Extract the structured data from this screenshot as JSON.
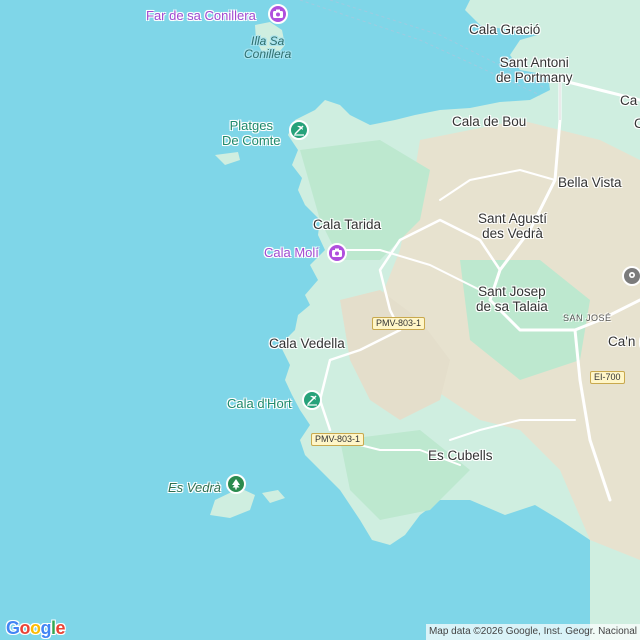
{
  "map": {
    "colors": {
      "water": "#7fd6e8",
      "land": "#cfeee0",
      "forest": "#b9e6cc",
      "terrain": "#e8e3d2",
      "road": "#ffffff",
      "accent_purple": "#b04fdd",
      "accent_green": "#27a27a"
    },
    "places": {
      "cala_gracio": "Cala Gració",
      "sant_antoni_1": "Sant Antoni",
      "sant_antoni_2": "de Portmany",
      "cala_de_bou": "Cala de Bou",
      "bella_vista": "Bella Vista",
      "sant_agusti_1": "Sant Agustí",
      "sant_agusti_2": "des Vedrà",
      "sant_josep_1": "Sant Josep",
      "sant_josep_2": "de sa Talaia",
      "cala_tarida": "Cala Tarida",
      "cala_vedella": "Cala Vedella",
      "es_cubells": "Es Cubells",
      "can_edge": "Ca'n (",
      "ca_top_edge": "Ca",
      "c_edge": "C"
    },
    "water_labels": {
      "illa_1": "Illa Sa",
      "illa_2": "Conillera"
    },
    "pois": {
      "far": {
        "label": "Far de sa Conillera",
        "icon": "camera-icon"
      },
      "platges_1": "Platges",
      "platges_2": "De Comte",
      "platges_icon": "beach-icon",
      "cala_moli": {
        "label": "Cala Molí",
        "icon": "camera-icon"
      },
      "cala_dhort": {
        "label": "Cala d'Hort",
        "icon": "beach-icon"
      },
      "es_vedra": {
        "label": "Es Vedrà",
        "icon": "tree-icon"
      }
    },
    "roads": {
      "pmv_top": "PMV-803-1",
      "pmv_bottom": "PMV-803-1",
      "ei700": "EI-700",
      "san_jose": "SAN JOSÉ"
    },
    "footer": {
      "logo": "Google",
      "attribution": "Map data ©2026 Google, Inst. Geogr. Nacional"
    }
  }
}
